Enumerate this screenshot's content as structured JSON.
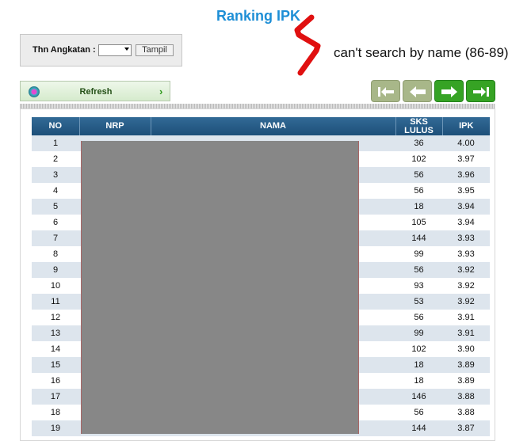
{
  "page": {
    "title": "Ranking IPK"
  },
  "filter": {
    "label": "Thn Angkatan :",
    "year_value": "",
    "button_label": "Tampil"
  },
  "annotation": {
    "text": "can't search by name (86-89)",
    "stroke_color": "#e01010"
  },
  "toolbar": {
    "refresh_label": "Refresh",
    "refresh_icon": "refresh-icon",
    "chevron_icon": "chevron-right-icon"
  },
  "pager": {
    "buttons": [
      {
        "name": "first-page-icon",
        "enabled": false
      },
      {
        "name": "prev-page-icon",
        "enabled": false
      },
      {
        "name": "next-page-icon",
        "enabled": true
      },
      {
        "name": "last-page-icon",
        "enabled": true
      }
    ]
  },
  "table": {
    "headers": {
      "no": "NO",
      "nrp": "NRP",
      "nama": "NAMA",
      "sks_line1": "SKS",
      "sks_line2": "LULUS",
      "ipk": "IPK"
    },
    "rows": [
      {
        "no": "1",
        "sks": "36",
        "ipk": "4.00"
      },
      {
        "no": "2",
        "sks": "102",
        "ipk": "3.97"
      },
      {
        "no": "3",
        "sks": "56",
        "ipk": "3.96"
      },
      {
        "no": "4",
        "sks": "56",
        "ipk": "3.95"
      },
      {
        "no": "5",
        "sks": "18",
        "ipk": "3.94"
      },
      {
        "no": "6",
        "sks": "105",
        "ipk": "3.94"
      },
      {
        "no": "7",
        "sks": "144",
        "ipk": "3.93"
      },
      {
        "no": "8",
        "sks": "99",
        "ipk": "3.93"
      },
      {
        "no": "9",
        "sks": "56",
        "ipk": "3.92"
      },
      {
        "no": "10",
        "sks": "93",
        "ipk": "3.92"
      },
      {
        "no": "11",
        "sks": "53",
        "ipk": "3.92"
      },
      {
        "no": "12",
        "sks": "56",
        "ipk": "3.91"
      },
      {
        "no": "13",
        "sks": "99",
        "ipk": "3.91"
      },
      {
        "no": "14",
        "sks": "102",
        "ipk": "3.90"
      },
      {
        "no": "15",
        "sks": "18",
        "ipk": "3.89"
      },
      {
        "no": "16",
        "sks": "18",
        "ipk": "3.89"
      },
      {
        "no": "17",
        "sks": "146",
        "ipk": "3.88"
      },
      {
        "no": "18",
        "sks": "56",
        "ipk": "3.88"
      },
      {
        "no": "19",
        "sks": "144",
        "ipk": "3.87"
      }
    ]
  }
}
